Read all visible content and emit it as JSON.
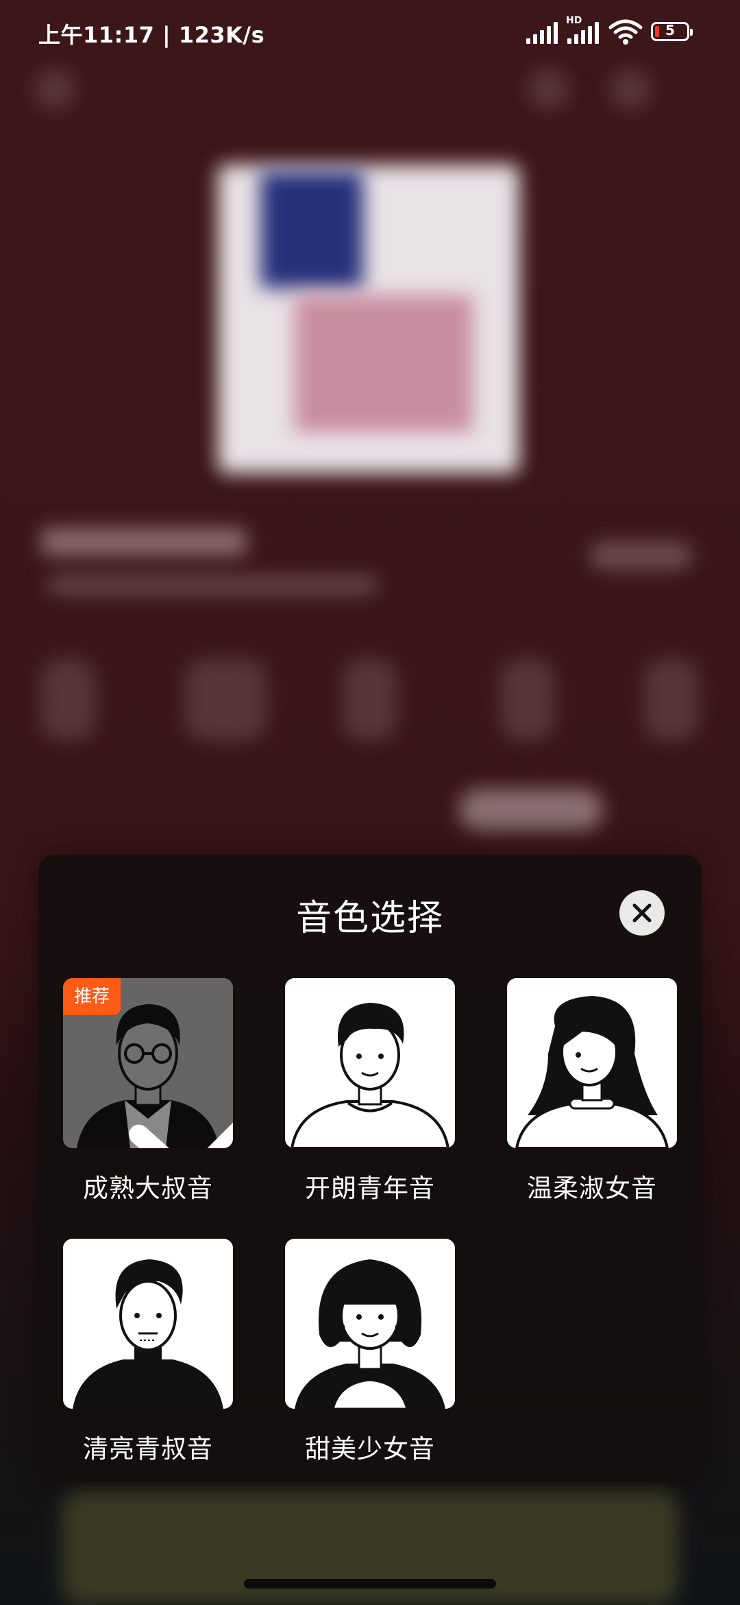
{
  "status_bar": {
    "time_speed": "上午11:17 | 123K/s",
    "hd": "HD",
    "battery": "5"
  },
  "modal": {
    "title": "音色选择",
    "badge": "推荐",
    "voices": [
      {
        "label": "成熟大叔音",
        "selected": true
      },
      {
        "label": "开朗青年音",
        "selected": false
      },
      {
        "label": "温柔淑女音",
        "selected": false
      },
      {
        "label": "清亮青叔音",
        "selected": false
      },
      {
        "label": "甜美少女音",
        "selected": false
      }
    ]
  },
  "icons": {
    "close": "close-icon",
    "check": "check-icon"
  },
  "colors": {
    "badge": "#ff5a16",
    "modal_bg": "#140e0f",
    "background": "#3a1518"
  }
}
